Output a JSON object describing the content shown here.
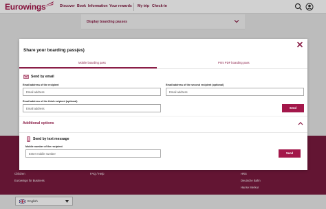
{
  "header": {
    "logo": "Eurowings",
    "nav": [
      "Discover",
      "Book",
      "Information",
      "Your rewards"
    ],
    "nav_right": [
      "My trip",
      "Check-in"
    ],
    "icons": [
      "search-icon",
      "user-icon"
    ]
  },
  "background": {
    "boarding_bar_label": "Display boarding passes",
    "footer_links": [
      "Children",
      "Eurowings for Business",
      "FAQ / Help",
      "HRS",
      "Deutsche Bahn",
      "Hanse Merkur"
    ],
    "language": "English"
  },
  "modal": {
    "title": "Share your boarding pass(es)",
    "tabs": [
      "Mobile boarding pass",
      "Print PDF boarding pass"
    ],
    "active_tab": 0,
    "email_section": {
      "title": "Send by email",
      "fields": [
        {
          "label": "Email address of the recipient",
          "placeholder": "Email address"
        },
        {
          "label": "Email address of the second recipient (optional)",
          "placeholder": "Email address"
        },
        {
          "label": "Email address of the third recipient (optional)",
          "placeholder": "Email address"
        }
      ],
      "send_label": "Send"
    },
    "additional_options": "Additional options",
    "sms_section": {
      "title": "Send by text message",
      "field_label": "Mobile number of the recipient",
      "placeholder": "Enter mobile number",
      "send_label": "Send"
    }
  },
  "colors": {
    "brand": "#a3174a",
    "footer": "#791a3f"
  }
}
